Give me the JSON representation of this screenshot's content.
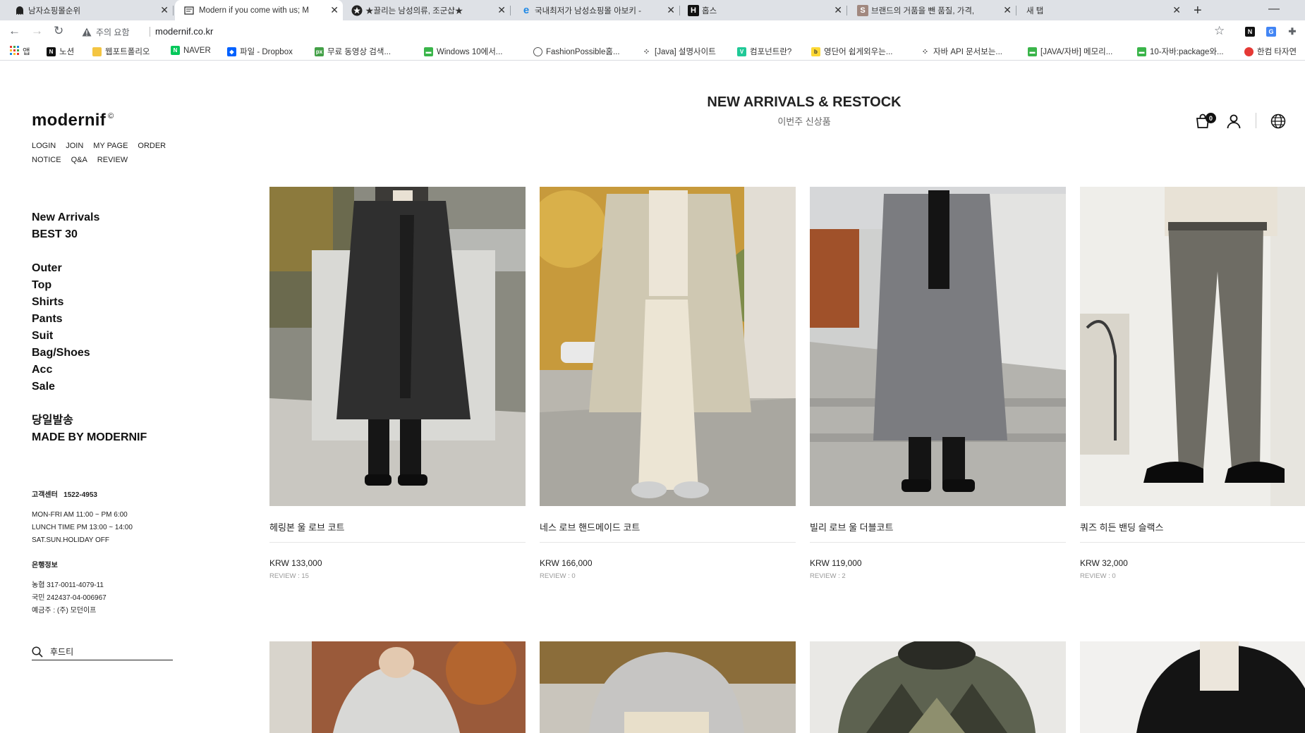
{
  "browser": {
    "tabs": [
      {
        "title": "남자쇼핑몰순위",
        "icon": "ghost-icon"
      },
      {
        "title": "Modern if you come with us; M",
        "icon": "page-icon"
      },
      {
        "title": "★끌리는 남성의류, 조군샵★",
        "icon": "star-badge-icon"
      },
      {
        "title": "국내최저가 남성쇼핑몰 아보키 -",
        "icon": "ie-icon"
      },
      {
        "title": "홉스",
        "icon": "h-icon"
      },
      {
        "title": "브랜드의 거품을 뺀 품질, 가격,",
        "icon": "s-icon"
      },
      {
        "title": "새 탭",
        "icon": ""
      }
    ],
    "security_label": "주의 요함",
    "url": "modernif.co.kr",
    "bookmarks": [
      "앱",
      "노션",
      "웹포트폴리오",
      "NAVER",
      "파일 - Dropbox",
      "무료 동영상 검색...",
      "Windows 10에서...",
      "FashionPossible홈...",
      "[Java] 설명사이트",
      "컴포넌트란?",
      "영단어 쉽게외우는...",
      "자바 API 문서보는...",
      "[JAVA/자바] 메모리...",
      "10-자바:package와...",
      "한컴 타자연"
    ]
  },
  "site": {
    "logo": "modernif",
    "logo_mark": "©",
    "top_links": [
      "LOGIN",
      "JOIN",
      "MY PAGE",
      "ORDER",
      "NOTICE",
      "Q&A",
      "REVIEW"
    ],
    "featured": [
      "New Arrivals",
      "BEST 30"
    ],
    "categories": [
      "Outer",
      "Top",
      "Shirts",
      "Pants",
      "Suit",
      "Bag/Shoes",
      "Acc",
      "Sale"
    ],
    "specials": [
      "당일발송",
      "MADE BY MODERNIF"
    ],
    "cs": {
      "label": "고객센터",
      "phone": "1522-4953",
      "hours": [
        "MON-FRI AM 11:00 ~ PM 6:00",
        "LUNCH TIME PM 13:00 ~ 14:00",
        "SAT.SUN.HOLIDAY OFF"
      ]
    },
    "bank": {
      "label": "은행정보",
      "lines": [
        "농협 317-0011-4079-11",
        "국민 242437-04-006967",
        "예금주 : (주) 모던이프"
      ]
    },
    "search_value": "후드티",
    "headline": "NEW ARRIVALS & RESTOCK",
    "subheadline": "이번주 신상품",
    "cart_count": "0",
    "products": [
      {
        "name": "헤링본 울 로브 코트",
        "price": "KRW 133,000",
        "review": "REVIEW : 15"
      },
      {
        "name": "네스 로브 핸드메이드 코트",
        "price": "KRW 166,000",
        "review": "REVIEW : 0"
      },
      {
        "name": "빌리 로브 울 더블코트",
        "price": "KRW 119,000",
        "review": "REVIEW : 2"
      },
      {
        "name": "쿼즈 히든 밴딩 슬랙스",
        "price": "KRW 32,000",
        "review": "REVIEW : 0"
      }
    ]
  }
}
